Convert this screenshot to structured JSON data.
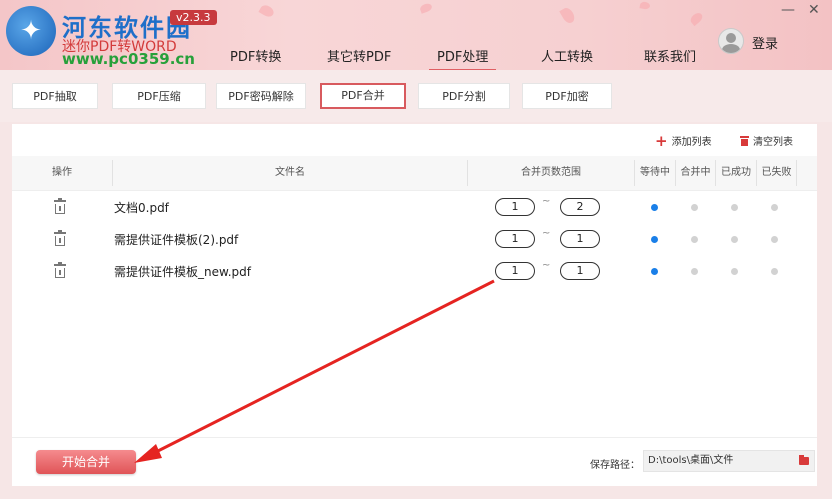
{
  "header": {
    "site_name": "河东软件园",
    "app_name": "迷你PDF转WORD",
    "site_url": "www.pc0359.cn",
    "version": "v2.3.3",
    "login_label": "登录",
    "minimize_glyph": "—",
    "close_glyph": "✕",
    "nav": [
      {
        "label": "PDF转换",
        "active": false
      },
      {
        "label": "其它转PDF",
        "active": false
      },
      {
        "label": "PDF处理",
        "active": true
      },
      {
        "label": "人工转换",
        "active": false
      },
      {
        "label": "联系我们",
        "active": false
      }
    ]
  },
  "subtabs": [
    {
      "label": "PDF抽取",
      "active": false
    },
    {
      "label": "PDF压缩",
      "active": false
    },
    {
      "label": "PDF密码解除",
      "active": false
    },
    {
      "label": "PDF合并",
      "active": true
    },
    {
      "label": "PDF分割",
      "active": false
    },
    {
      "label": "PDF加密",
      "active": false
    }
  ],
  "toolbar": {
    "add_list": "添加列表",
    "clear_list": "清空列表"
  },
  "table": {
    "columns": {
      "action": "操作",
      "filename": "文件名",
      "page_range": "合并页数范围",
      "waiting": "等待中",
      "merging": "合并中",
      "success": "已成功",
      "failed": "已失败"
    },
    "range_separator": "~",
    "rows": [
      {
        "filename": "文档0.pdf",
        "from": "1",
        "to": "2",
        "status": "waiting"
      },
      {
        "filename": "需提供证件模板(2).pdf",
        "from": "1",
        "to": "1",
        "status": "waiting"
      },
      {
        "filename": "需提供证件模板_new.pdf",
        "from": "1",
        "to": "1",
        "status": "waiting"
      }
    ]
  },
  "footer": {
    "start_button": "开始合并",
    "save_label": "保存路径：",
    "save_path": "D:\\tools\\桌面\\文件"
  },
  "colors": {
    "accent": "#e05457",
    "status_on": "#1a7fe8",
    "arrow": "#e52421"
  }
}
